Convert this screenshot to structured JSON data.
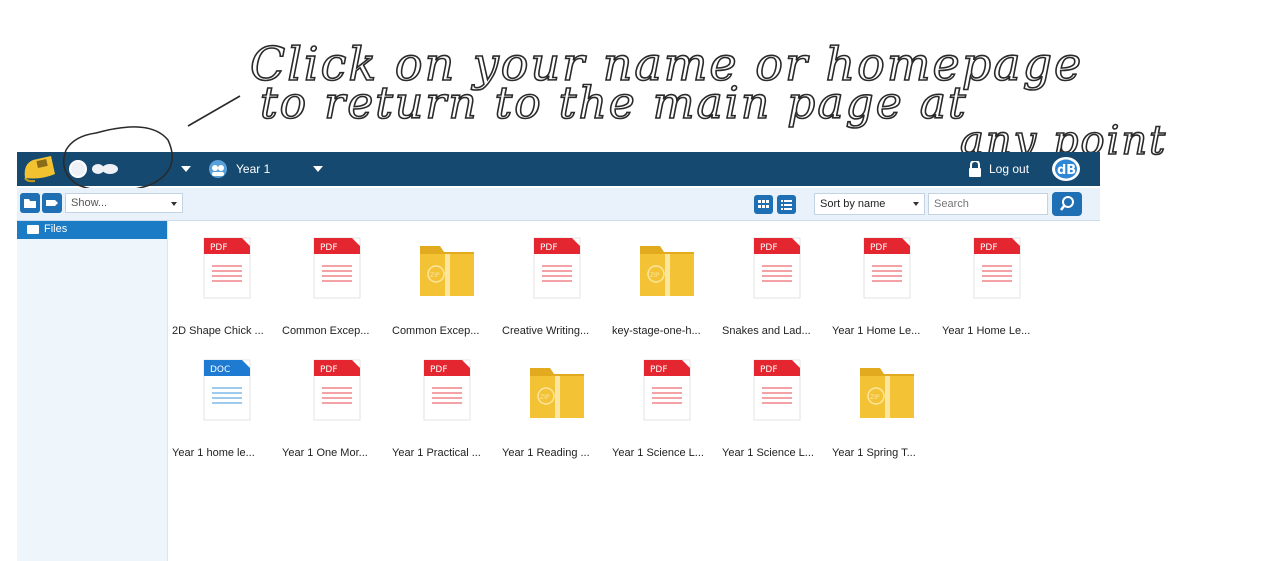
{
  "annotation": {
    "line1": "Click on your name or homepage",
    "line2": "to return to the main page at",
    "line3": "any point"
  },
  "topbar": {
    "year_label": "Year 1",
    "logout_label": "Log out",
    "colors": {
      "bar": "#16496f",
      "accent": "#1f6fb5"
    }
  },
  "toolbar": {
    "show_value": "Show...",
    "sort_value": "Sort by name",
    "search_placeholder": "Search"
  },
  "sidebar": {
    "items": [
      {
        "label": "Files",
        "icon": "folder-icon",
        "selected": true
      }
    ]
  },
  "files": [
    {
      "name": "2D Shape Chick ...",
      "type": "PDF"
    },
    {
      "name": "Common Excep...",
      "type": "PDF"
    },
    {
      "name": "Common Excep...",
      "type": "ZIP"
    },
    {
      "name": "Creative Writing...",
      "type": "PDF"
    },
    {
      "name": "key-stage-one-h...",
      "type": "ZIP"
    },
    {
      "name": "Snakes and Lad...",
      "type": "PDF"
    },
    {
      "name": "Year 1 Home Le...",
      "type": "PDF"
    },
    {
      "name": "Year 1 Home Le...",
      "type": "PDF"
    },
    {
      "name": "Year 1 home le...",
      "type": "DOC"
    },
    {
      "name": "Year 1 One Mor...",
      "type": "PDF"
    },
    {
      "name": "Year 1 Practical ...",
      "type": "PDF"
    },
    {
      "name": "Year 1 Reading ...",
      "type": "ZIP"
    },
    {
      "name": "Year 1 Science L...",
      "type": "PDF"
    },
    {
      "name": "Year 1 Science L...",
      "type": "PDF"
    },
    {
      "name": "Year 1 Spring T...",
      "type": "ZIP"
    }
  ]
}
